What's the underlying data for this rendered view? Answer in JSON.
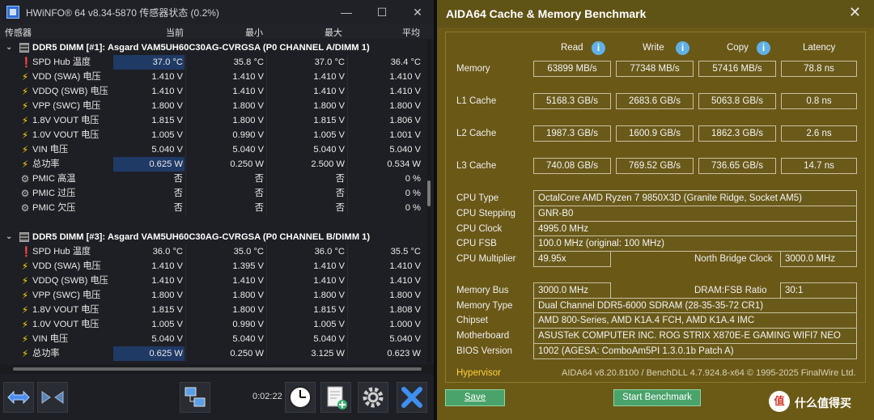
{
  "hwinfo": {
    "title": "HWiNFO® 64 v8.34-5870 传感器状态 (0.2%)",
    "columns": {
      "sensor": "传感器",
      "current": "当前",
      "min": "最小",
      "max": "最大",
      "avg": "平均"
    },
    "groups": [
      {
        "name": "DDR5 DIMM [#1]: Asgard VAM5UH60C30AG-CVRGSA (P0 CHANNEL A/DIMM 1)",
        "rows": [
          {
            "icon": "thermometer-icon",
            "name": "SPD Hub 温度",
            "cur": "37.0 °C",
            "min": "35.8 °C",
            "max": "37.0 °C",
            "avg": "36.4 °C",
            "hl": true
          },
          {
            "icon": "voltage-icon",
            "name": "VDD (SWA) 电压",
            "cur": "1.410 V",
            "min": "1.410 V",
            "max": "1.410 V",
            "avg": "1.410 V"
          },
          {
            "icon": "voltage-icon",
            "name": "VDDQ (SWB) 电压",
            "cur": "1.410 V",
            "min": "1.410 V",
            "max": "1.410 V",
            "avg": "1.410 V"
          },
          {
            "icon": "voltage-icon",
            "name": "VPP (SWC) 电压",
            "cur": "1.800 V",
            "min": "1.800 V",
            "max": "1.800 V",
            "avg": "1.800 V"
          },
          {
            "icon": "voltage-icon",
            "name": "1.8V VOUT 电压",
            "cur": "1.815 V",
            "min": "1.800 V",
            "max": "1.815 V",
            "avg": "1.806 V"
          },
          {
            "icon": "voltage-icon",
            "name": "1.0V VOUT 电压",
            "cur": "1.005 V",
            "min": "0.990 V",
            "max": "1.005 V",
            "avg": "1.001 V"
          },
          {
            "icon": "voltage-icon",
            "name": "VIN 电压",
            "cur": "5.040 V",
            "min": "5.040 V",
            "max": "5.040 V",
            "avg": "5.040 V"
          },
          {
            "icon": "power-icon",
            "name": "总功率",
            "cur": "0.625 W",
            "min": "0.250 W",
            "max": "2.500 W",
            "avg": "0.534 W",
            "hl": true
          },
          {
            "icon": "gear-icon",
            "name": "PMIC 高温",
            "cur": "否",
            "min": "否",
            "max": "否",
            "avg": "0 %"
          },
          {
            "icon": "gear-icon",
            "name": "PMIC 过压",
            "cur": "否",
            "min": "否",
            "max": "否",
            "avg": "0 %"
          },
          {
            "icon": "gear-icon",
            "name": "PMIC 欠压",
            "cur": "否",
            "min": "否",
            "max": "否",
            "avg": "0 %"
          }
        ]
      },
      {
        "name": "DDR5 DIMM [#3]: Asgard VAM5UH60C30AG-CVRGSA (P0 CHANNEL B/DIMM 1)",
        "rows": [
          {
            "icon": "thermometer-icon",
            "name": "SPD Hub 温度",
            "cur": "36.0 °C",
            "min": "35.0 °C",
            "max": "36.0 °C",
            "avg": "35.5 °C"
          },
          {
            "icon": "voltage-icon",
            "name": "VDD (SWA) 电压",
            "cur": "1.410 V",
            "min": "1.395 V",
            "max": "1.410 V",
            "avg": "1.410 V"
          },
          {
            "icon": "voltage-icon",
            "name": "VDDQ (SWB) 电压",
            "cur": "1.410 V",
            "min": "1.410 V",
            "max": "1.410 V",
            "avg": "1.410 V"
          },
          {
            "icon": "voltage-icon",
            "name": "VPP (SWC) 电压",
            "cur": "1.800 V",
            "min": "1.800 V",
            "max": "1.800 V",
            "avg": "1.800 V"
          },
          {
            "icon": "voltage-icon",
            "name": "1.8V VOUT 电压",
            "cur": "1.815 V",
            "min": "1.800 V",
            "max": "1.815 V",
            "avg": "1.808 V"
          },
          {
            "icon": "voltage-icon",
            "name": "1.0V VOUT 电压",
            "cur": "1.005 V",
            "min": "0.990 V",
            "max": "1.005 V",
            "avg": "1.000 V"
          },
          {
            "icon": "voltage-icon",
            "name": "VIN 电压",
            "cur": "5.040 V",
            "min": "5.040 V",
            "max": "5.040 V",
            "avg": "5.040 V"
          },
          {
            "icon": "power-icon",
            "name": "总功率",
            "cur": "0.625 W",
            "min": "0.250 W",
            "max": "3.125 W",
            "avg": "0.623 W",
            "hl": true
          }
        ]
      }
    ],
    "timer": "0:02:22"
  },
  "aida": {
    "title": "AIDA64 Cache & Memory Benchmark",
    "columns": {
      "read": "Read",
      "write": "Write",
      "copy": "Copy",
      "latency": "Latency"
    },
    "bench": [
      {
        "label": "Memory",
        "read": "63899 MB/s",
        "write": "77348 MB/s",
        "copy": "57416 MB/s",
        "latency": "78.8 ns"
      },
      {
        "label": "L1 Cache",
        "read": "5168.3 GB/s",
        "write": "2683.6 GB/s",
        "copy": "5063.8 GB/s",
        "latency": "0.8 ns"
      },
      {
        "label": "L2 Cache",
        "read": "1987.3 GB/s",
        "write": "1600.9 GB/s",
        "copy": "1862.3 GB/s",
        "latency": "2.6 ns"
      },
      {
        "label": "L3 Cache",
        "read": "740.08 GB/s",
        "write": "769.52 GB/s",
        "copy": "736.65 GB/s",
        "latency": "14.7 ns"
      }
    ],
    "cpu": {
      "type_label": "CPU Type",
      "type": "OctalCore AMD Ryzen 7 9850X3D  (Granite Ridge, Socket AM5)",
      "stepping_label": "CPU Stepping",
      "stepping": "GNR-B0",
      "clock_label": "CPU Clock",
      "clock": "4995.0 MHz",
      "fsb_label": "CPU FSB",
      "fsb": "100.0 MHz  (original: 100 MHz)",
      "mult_label": "CPU Multiplier",
      "mult": "49.95x",
      "nb_label": "North Bridge Clock",
      "nb": "3000.0 MHz"
    },
    "sys": {
      "membus_label": "Memory Bus",
      "membus": "3000.0 MHz",
      "ratio_label": "DRAM:FSB Ratio",
      "ratio": "30:1",
      "memtype_label": "Memory Type",
      "memtype": "Dual Channel DDR5-6000 SDRAM  (28-35-35-72 CR1)",
      "chipset_label": "Chipset",
      "chipset": "AMD 800-Series, AMD K1A.4 FCH, AMD K1A.4 IMC",
      "mobo_label": "Motherboard",
      "mobo": "ASUSTeK COMPUTER INC. ROG STRIX X870E-E GAMING WIFI7 NEO",
      "bios_label": "BIOS Version",
      "bios": "1002  (AGESA: ComboAm5PI 1.3.0.1b Patch A)"
    },
    "hypervisor": "Hypervisor",
    "footer": "AIDA64 v8.20.8100 / BenchDLL 4.7.924.8-x64  © 1995-2025 FinalWire Ltd.",
    "save_label": "Save",
    "start_label": "Start Benchmark",
    "watermark": "什么值得买",
    "watermark_icon": "值"
  }
}
